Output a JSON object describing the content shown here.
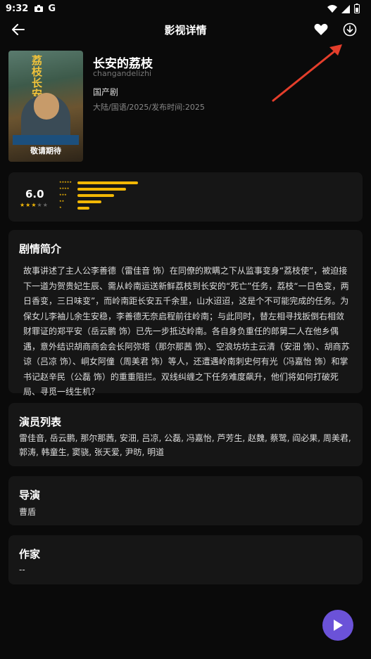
{
  "status_bar": {
    "time": "9:32",
    "app_initial": "G"
  },
  "topbar": {
    "title": "影视详情"
  },
  "movie": {
    "poster_title": "荔枝长安",
    "poster_release": "敬请期待",
    "title": "长安的荔枝",
    "pinyin": "changandelizhi",
    "genre": "国产剧",
    "meta": "大陆/国语/2025/发布时间:2025"
  },
  "rating": {
    "score": "6.0",
    "stars": {
      "filled": 3,
      "total": 5
    },
    "distribution": [
      {
        "stars": 5,
        "fraction": 1.0
      },
      {
        "stars": 4,
        "fraction": 0.8
      },
      {
        "stars": 3,
        "fraction": 0.6
      },
      {
        "stars": 2,
        "fraction": 0.4
      },
      {
        "stars": 1,
        "fraction": 0.2
      }
    ],
    "accent_color": "#f2b705"
  },
  "plot": {
    "title": "剧情简介",
    "text": "故事讲述了主人公李善德（雷佳音 饰）在同僚的欺瞒之下从监事变身“荔枝使”，被迫接下一道为贺贵妃生辰、需从岭南运送新鲜荔枝到长安的“死亡”任务，荔枝“一日色变，两日香变，三日味变”，而岭南距长安五千余里，山水迢迢，这是个不可能完成的任务。为保女儿李袖儿余生安稳，李善德无奈启程前往岭南；与此同时，替左相寻找扳倒右相敛财罪证的郑平安（岳云鹏 饰）已先一步抵达岭南。各自身负重任的郎舅二人在他乡偶遇，意外结识胡商商会会长阿弥塔（那尔那茜 饰）、空浪坊坊主云清（安沺 饰）、胡商苏谅（吕凉 饰）、峒女阿僮（周美君 饰）等人，还遭遇岭南刺史何有光（冯嘉怡 饰）和掌书记赵辛民（公磊 饰）的重重阻拦。双线纠缠之下任务难度飙升，他们将如何打破死局、寻觅一线生机？"
  },
  "cast": {
    "title": "演员列表",
    "text": "雷佳音, 岳云鹏, 那尔那茜, 安沺, 吕凉, 公磊, 冯嘉怡, 芦芳生, 赵魏, 蔡鹭, 阎必果, 周美君, 郭涛, 韩童生, 窦骁, 张天爱, 尹昉, 明道"
  },
  "director": {
    "title": "导演",
    "name": "曹盾"
  },
  "writer": {
    "title": "作家",
    "name": "--"
  },
  "play_button": {
    "color": "#6b52d8"
  }
}
